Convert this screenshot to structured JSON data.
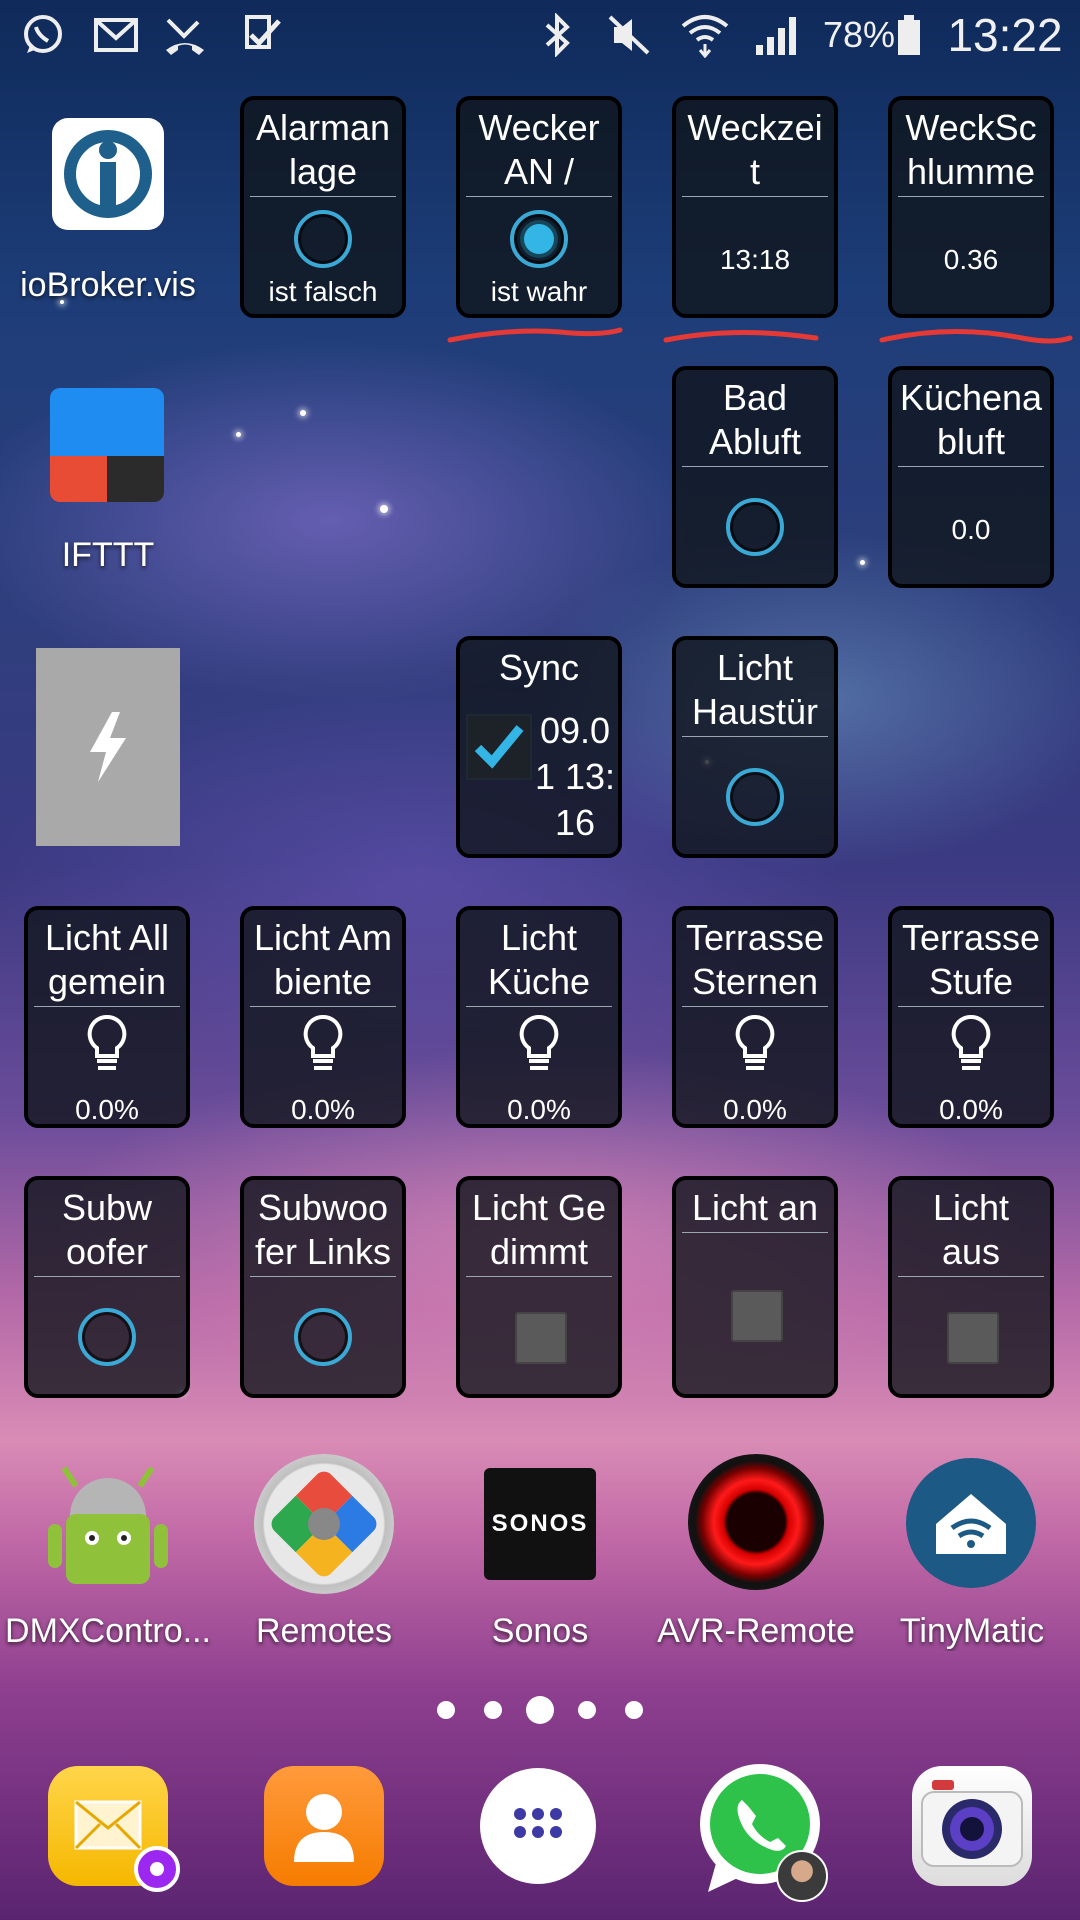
{
  "status_bar": {
    "battery_percent": "78%",
    "time": "13:22",
    "icons": [
      "whatsapp-icon",
      "mail-icon",
      "missed-call-icon",
      "task-check-icon",
      "bluetooth-icon",
      "mute-icon",
      "wifi-icon",
      "signal-icon",
      "battery-icon"
    ]
  },
  "widgets": {
    "alarmanlage": {
      "title": "Alarman\nlage",
      "value": "ist falsch"
    },
    "wecker": {
      "title": "Wecker\nAN /",
      "value": "ist wahr"
    },
    "weckzeit": {
      "title": "Weckzei\nt",
      "value": "13:18"
    },
    "weckschlummer": {
      "title": "WeckSc\nhlumme",
      "value": "0.36"
    },
    "bad_abluft": {
      "title": "Bad\nAbluft"
    },
    "kuechen_abluft": {
      "title": "Küchena\nbluft",
      "value": "0.0"
    },
    "sync": {
      "title": "Sync",
      "value": "09.0\n1 13:\n16"
    },
    "licht_haustuer": {
      "title": "Licht\nHaustür"
    },
    "licht_allgemein": {
      "title": "Licht All\ngemein",
      "value": "0.0%"
    },
    "licht_ambiente": {
      "title": "Licht Am\nbiente",
      "value": "0.0%"
    },
    "licht_kueche": {
      "title": "Licht\nKüche",
      "value": "0.0%"
    },
    "terrasse_sternen": {
      "title": "Terrasse\nSternen",
      "value": "0.0%"
    },
    "terrasse_stufe": {
      "title": "Terrasse\nStufe",
      "value": "0.0%"
    },
    "subwoofer": {
      "title": "Subw\noofer"
    },
    "subwoofer_links": {
      "title": "Subwoo\nfer Links"
    },
    "licht_gedimmt": {
      "title": "Licht Ge\ndimmt"
    },
    "licht_an": {
      "title": "Licht an"
    },
    "licht_aus": {
      "title": "Licht\naus"
    }
  },
  "apps": {
    "iobroker": "ioBroker.vis",
    "ifttt": "IFTTT",
    "dmxcontrol": "DMXContro...",
    "remotes": "Remotes",
    "sonos": "Sonos",
    "sonos_logo": "SONOS",
    "avr_remote": "AVR-Remote",
    "tinymatic": "TinyMatic"
  },
  "page_indicator": {
    "count": 5,
    "active": 3
  },
  "colors": {
    "accent": "#33b5e5",
    "ring": "#3aa9d6",
    "annotation_underline": "#e53935"
  }
}
